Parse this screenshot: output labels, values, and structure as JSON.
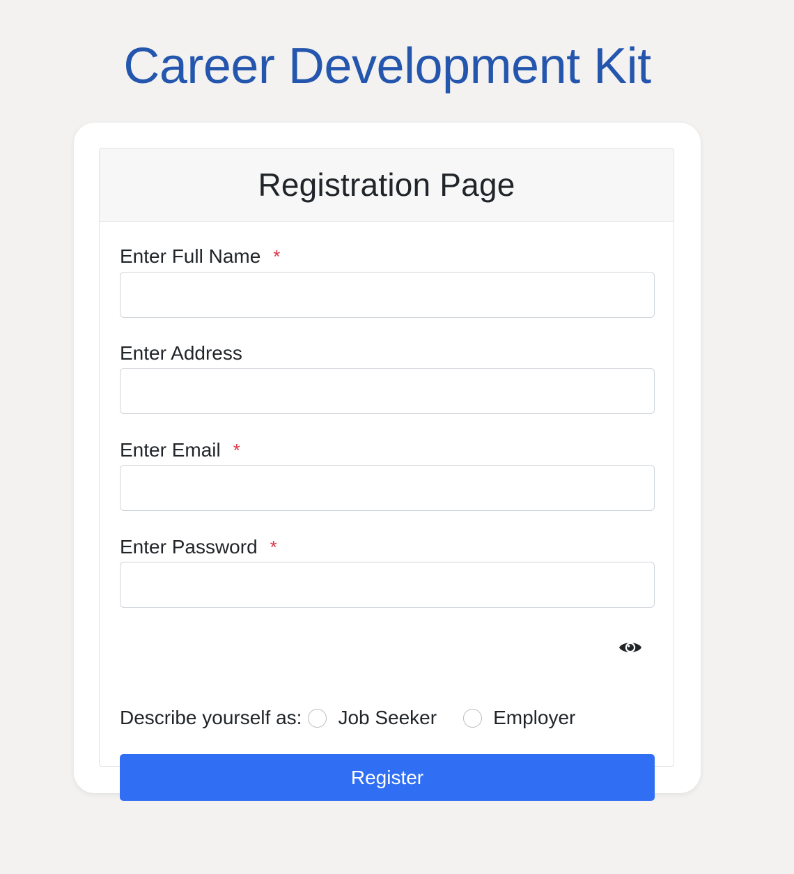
{
  "site": {
    "title": "Career Development Kit"
  },
  "card": {
    "title": "Registration Page"
  },
  "form": {
    "full_name": {
      "label": "Enter Full Name",
      "required_marker": "*",
      "value": "",
      "placeholder": ""
    },
    "address": {
      "label": "Enter Address",
      "value": "",
      "placeholder": ""
    },
    "email": {
      "label": "Enter Email",
      "required_marker": "*",
      "value": "",
      "placeholder": ""
    },
    "password": {
      "label": "Enter Password",
      "required_marker": "*",
      "value": "",
      "placeholder": "",
      "toggle_icon": "eye-icon"
    },
    "role": {
      "label": "Describe yourself as:",
      "options": [
        {
          "label": "Job Seeker",
          "selected": false
        },
        {
          "label": "Employer",
          "selected": false
        }
      ]
    },
    "submit_label": "Register"
  },
  "colors": {
    "page_background": "#f3f2f1",
    "title_blue": "#2456ad",
    "button_blue": "#306ef4",
    "required_red": "#dc3545",
    "header_background": "#f7f7f7"
  }
}
